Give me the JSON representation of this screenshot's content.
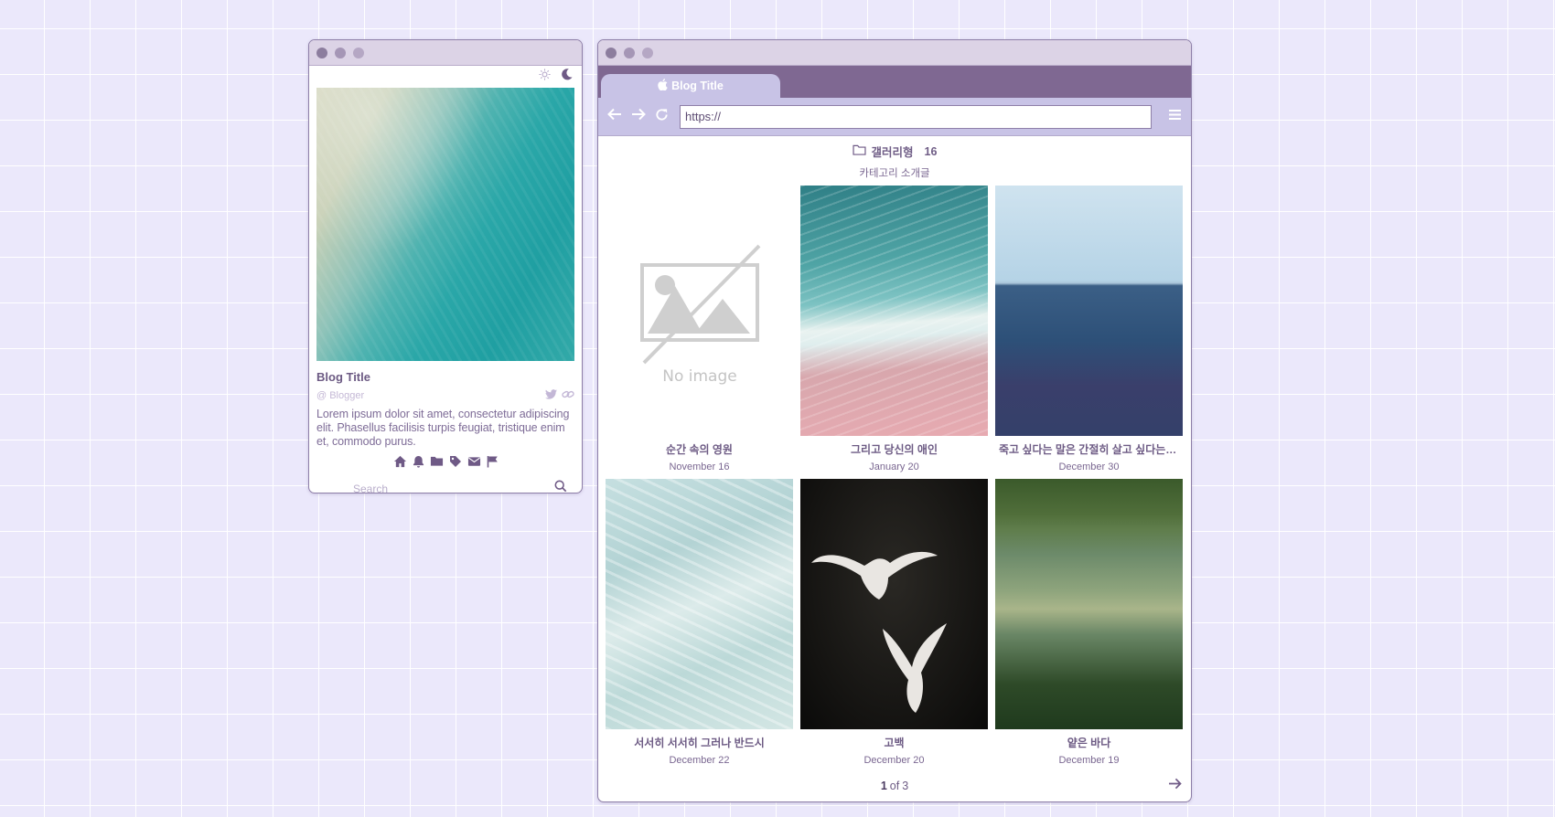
{
  "left_window": {
    "blog_title": "Blog Title",
    "blogger": "@ Blogger",
    "description": "Lorem ipsum dolor sit amet, consectetur adipiscing elit. Phasellus facilisis turpis feugiat, tristique enim et, commodo purus.",
    "search_placeholder": "Search",
    "nav_icons": [
      "home-icon",
      "bell-icon",
      "folder-icon",
      "tag-icon",
      "mail-icon",
      "flag-icon"
    ]
  },
  "browser": {
    "tab_title": "Blog Title",
    "url": "https://",
    "category": {
      "name": "갤러리형",
      "count": "16",
      "description": "카테고리 소개글"
    },
    "no_image_label": "No image",
    "posts": [
      {
        "title": "순간 속의 영원",
        "date": "November 16"
      },
      {
        "title": "그리고 당신의 애인",
        "date": "January 20"
      },
      {
        "title": "죽고 싶다는 말은 간절히 살고 싶다는 말이다",
        "date": "December 30"
      },
      {
        "title": "서서히 서서히 그러나 반드시",
        "date": "December 22"
      },
      {
        "title": "고백",
        "date": "December 20"
      },
      {
        "title": "얕은 바다",
        "date": "December 19"
      }
    ],
    "pager": {
      "current": "1",
      "of_label": "of",
      "total": "3"
    }
  },
  "colors": {
    "background": "#ebe8fb",
    "accent": "#7f6892",
    "tab": "#c8c3e6",
    "text": "#7a6791"
  }
}
